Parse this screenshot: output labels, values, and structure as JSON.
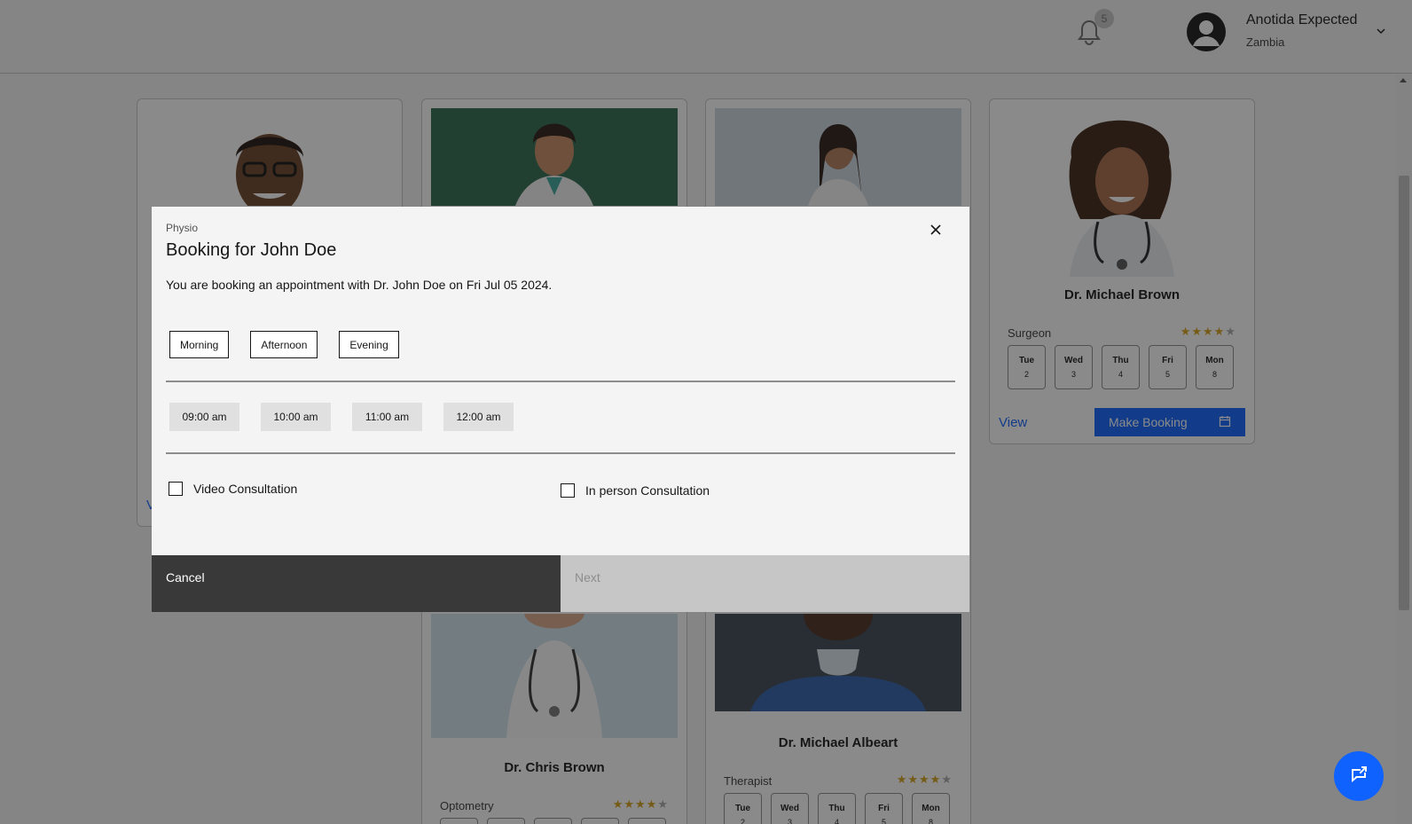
{
  "header": {
    "notification_count": "5",
    "user_name": "Anotida Expected",
    "user_country": "Zambia",
    "icons": [
      "notification-bell",
      "user-avatar",
      "chevron-down"
    ]
  },
  "colors": {
    "primary": "#0f62fe",
    "star": "#d4a017",
    "dark": "#393939"
  },
  "cards": [
    {
      "name": "Dr. Michael Brown",
      "specialty": "Surgeon",
      "rating": 4,
      "days": [
        {
          "name": "Tue",
          "date": "2"
        },
        {
          "name": "Wed",
          "date": "3"
        },
        {
          "name": "Thu",
          "date": "4"
        },
        {
          "name": "Fri",
          "date": "5"
        },
        {
          "name": "Mon",
          "date": "8"
        }
      ],
      "view_label": "View",
      "book_label": "Make Booking"
    },
    {
      "name": "Dr. Chris Brown",
      "specialty": "Optometry",
      "rating": 4
    },
    {
      "name": "Dr. Michael Albeart",
      "specialty": "Therapist",
      "rating": 4,
      "days": [
        {
          "name": "Tue",
          "date": "2"
        },
        {
          "name": "Wed",
          "date": "3"
        },
        {
          "name": "Thu",
          "date": "4"
        },
        {
          "name": "Fri",
          "date": "5"
        },
        {
          "name": "Mon",
          "date": "8"
        }
      ]
    }
  ],
  "modal": {
    "label": "Physio",
    "title": "Booking for John Doe",
    "description": "You are booking an appointment with Dr. John Doe on Fri Jul 05 2024.",
    "periods": [
      "Morning",
      "Afternoon",
      "Evening"
    ],
    "slots": [
      "09:00 am",
      "10:00 am",
      "11:00 am",
      "12:00 am"
    ],
    "video_label": "Video Consultation",
    "inperson_label": "In person Consultation",
    "cancel_label": "Cancel",
    "next_label": "Next"
  }
}
